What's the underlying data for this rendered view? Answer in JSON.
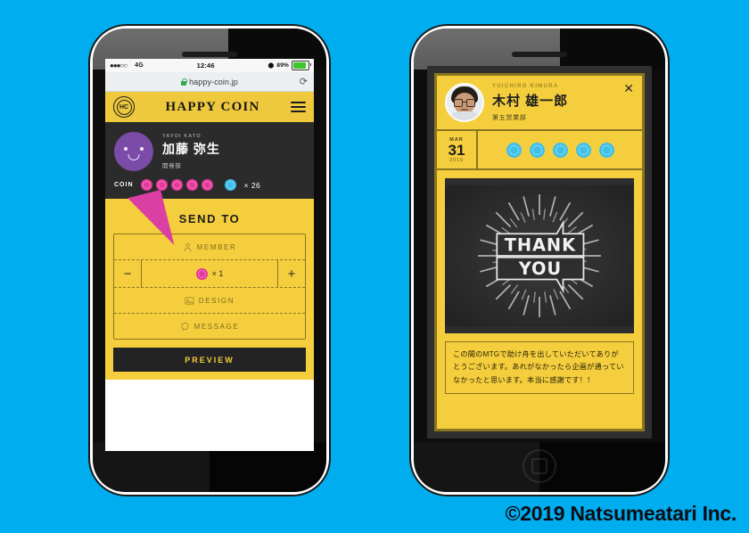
{
  "background_color": "#00AEEF",
  "copyright": "©2019 Natsumeatari Inc.",
  "phone1": {
    "status_bar": {
      "signal_dots": "●●●○○",
      "network": "4G",
      "time": "12:46",
      "battery_percent": "89%",
      "lock_icon": "lock-icon"
    },
    "browser": {
      "url": "happy-coin.jp",
      "secure_icon": "green-lock-icon",
      "reload_icon": "reload-icon"
    },
    "appbar": {
      "logo_glyph": "HC",
      "brand": "HAPPY COIN",
      "menu_icon": "hamburger-icon"
    },
    "profile": {
      "name_en": "YAYOI KATO",
      "name_jp": "加藤 弥生",
      "department": "開発部",
      "coin_label": "COIN",
      "pink_coins": 5,
      "blue_coin_count": "× 26"
    },
    "send": {
      "heading": "SEND TO",
      "member_placeholder": "MEMBER",
      "member_icon": "person-icon",
      "minus_label": "−",
      "plus_label": "+",
      "quantity": "× 1",
      "design_placeholder": "DESIGN",
      "design_icon": "image-icon",
      "message_placeholder": "MESSAGE",
      "message_icon": "chat-icon",
      "preview_button": "PREVIEW"
    }
  },
  "phone2": {
    "card": {
      "close_icon": "close-icon",
      "name_en": "YUICHIRO KIMURA",
      "name_jp": "木村 雄一郎",
      "department": "第五営業部",
      "date_month": "MAR",
      "date_day": "31",
      "date_year": "2019",
      "blue_coins": 5,
      "image": {
        "line1": "THANK",
        "line2": "YOU",
        "style": "chalkboard-sunburst-banner"
      },
      "message": "この間のMTGで助け舟を出していただいてありがとうございます。あれがなかったら企画が通っていなかったと思います。本当に感謝です！！"
    }
  }
}
